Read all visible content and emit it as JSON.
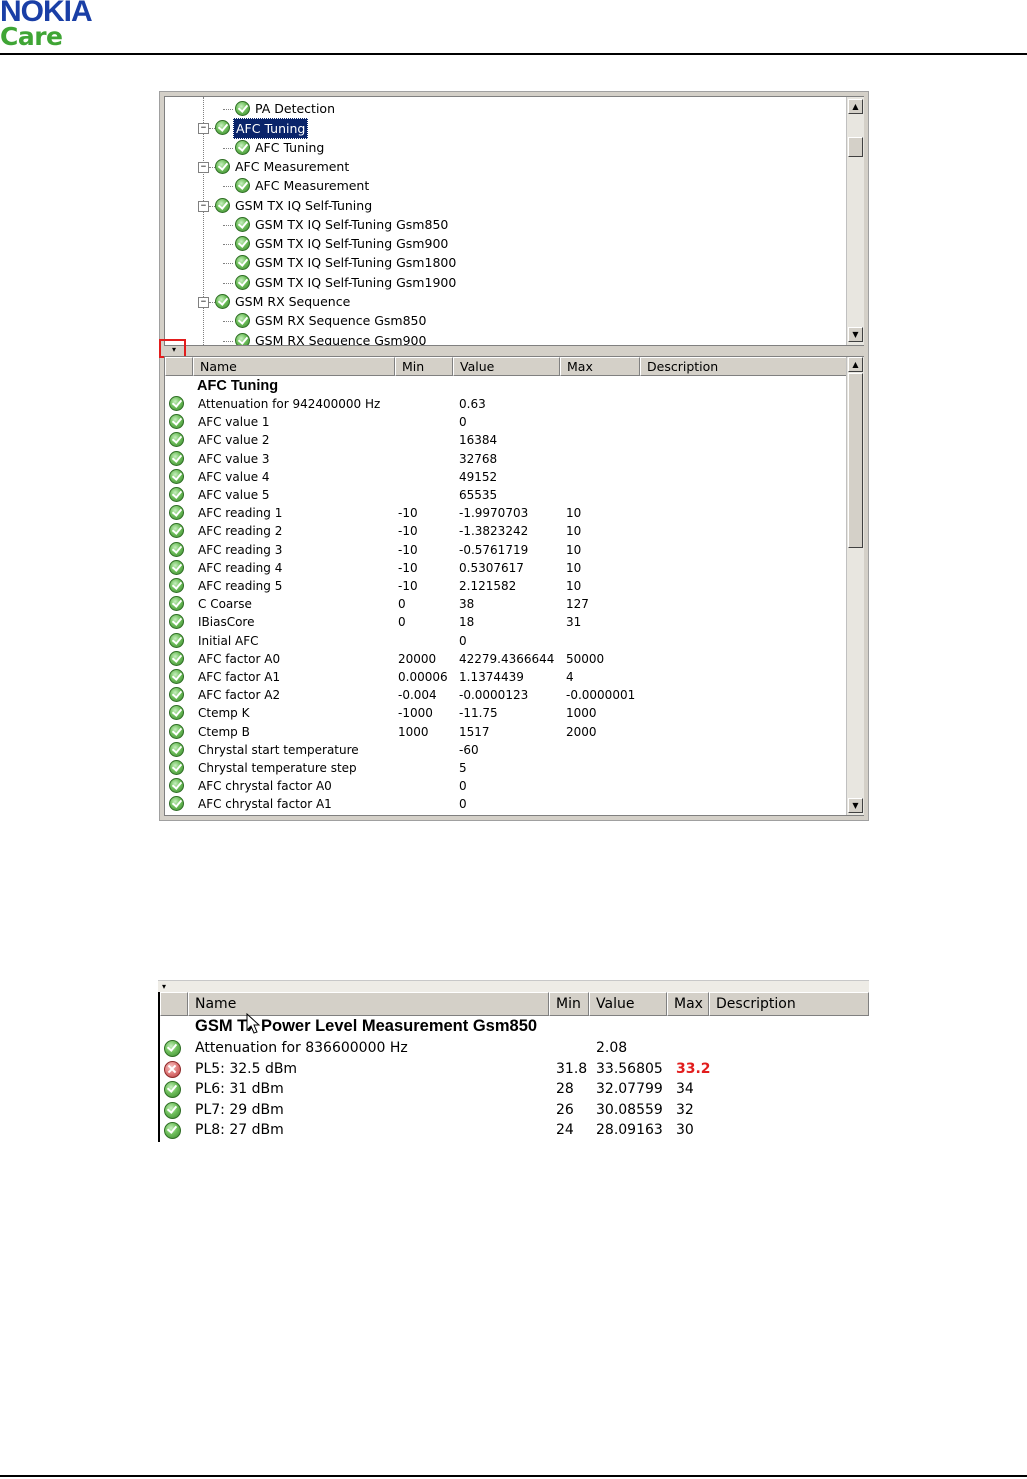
{
  "header": {
    "brand_primary": "NOKIA",
    "brand_secondary": "Care"
  },
  "tree": {
    "items": [
      {
        "label": "PA Detection",
        "level": 2,
        "expander": ""
      },
      {
        "label": "AFC Tuning",
        "level": 1,
        "expander": "-",
        "selected": true
      },
      {
        "label": "AFC Tuning",
        "level": 2,
        "expander": ""
      },
      {
        "label": "AFC Measurement",
        "level": 1,
        "expander": "-"
      },
      {
        "label": "AFC Measurement",
        "level": 2,
        "expander": ""
      },
      {
        "label": "GSM TX IQ Self-Tuning",
        "level": 1,
        "expander": "-"
      },
      {
        "label": "GSM TX IQ Self-Tuning Gsm850",
        "level": 2,
        "expander": ""
      },
      {
        "label": "GSM TX IQ Self-Tuning Gsm900",
        "level": 2,
        "expander": ""
      },
      {
        "label": "GSM TX IQ Self-Tuning Gsm1800",
        "level": 2,
        "expander": ""
      },
      {
        "label": "GSM TX IQ Self-Tuning Gsm1900",
        "level": 2,
        "expander": ""
      },
      {
        "label": "GSM RX Sequence",
        "level": 1,
        "expander": "-"
      },
      {
        "label": "GSM RX Sequence Gsm850",
        "level": 2,
        "expander": ""
      },
      {
        "label": "GSM RX Sequence Gsm900",
        "level": 2,
        "expander": ""
      }
    ]
  },
  "grid1": {
    "columns": [
      "Name",
      "Min",
      "Value",
      "Max",
      "Description"
    ],
    "title": "AFC Tuning",
    "rows": [
      {
        "status": "pass",
        "name": "Attenuation for 942400000 Hz",
        "min": "",
        "value": "0.63",
        "max": ""
      },
      {
        "status": "pass",
        "name": "AFC value 1",
        "min": "",
        "value": "0",
        "max": ""
      },
      {
        "status": "pass",
        "name": "AFC value 2",
        "min": "",
        "value": "16384",
        "max": ""
      },
      {
        "status": "pass",
        "name": "AFC value 3",
        "min": "",
        "value": "32768",
        "max": ""
      },
      {
        "status": "pass",
        "name": "AFC value 4",
        "min": "",
        "value": "49152",
        "max": ""
      },
      {
        "status": "pass",
        "name": "AFC value 5",
        "min": "",
        "value": "65535",
        "max": ""
      },
      {
        "status": "pass",
        "name": "AFC reading 1",
        "min": "-10",
        "value": "-1.9970703",
        "max": "10"
      },
      {
        "status": "pass",
        "name": "AFC reading 2",
        "min": "-10",
        "value": "-1.3823242",
        "max": "10"
      },
      {
        "status": "pass",
        "name": "AFC reading 3",
        "min": "-10",
        "value": "-0.5761719",
        "max": "10"
      },
      {
        "status": "pass",
        "name": "AFC reading 4",
        "min": "-10",
        "value": "0.5307617",
        "max": "10"
      },
      {
        "status": "pass",
        "name": "AFC reading 5",
        "min": "-10",
        "value": "2.121582",
        "max": "10"
      },
      {
        "status": "pass",
        "name": "C Coarse",
        "min": "0",
        "value": "38",
        "max": "127"
      },
      {
        "status": "pass",
        "name": "IBiasCore",
        "min": "0",
        "value": "18",
        "max": "31"
      },
      {
        "status": "pass",
        "name": "Initial AFC",
        "min": "",
        "value": "0",
        "max": ""
      },
      {
        "status": "pass",
        "name": "AFC factor A0",
        "min": "20000",
        "value": "42279.4366644",
        "max": "50000"
      },
      {
        "status": "pass",
        "name": "AFC factor A1",
        "min": "0.00006",
        "value": "1.1374439",
        "max": "4"
      },
      {
        "status": "pass",
        "name": "AFC factor A2",
        "min": "-0.004",
        "value": "-0.0000123",
        "max": "-0.0000001"
      },
      {
        "status": "pass",
        "name": "Ctemp K",
        "min": "-1000",
        "value": "-11.75",
        "max": "1000"
      },
      {
        "status": "pass",
        "name": "Ctemp B",
        "min": "1000",
        "value": "1517",
        "max": "2000"
      },
      {
        "status": "pass",
        "name": "Chrystal start temperature",
        "min": "",
        "value": "-60",
        "max": ""
      },
      {
        "status": "pass",
        "name": "Chrystal temperature step",
        "min": "",
        "value": "5",
        "max": ""
      },
      {
        "status": "pass",
        "name": "AFC chrystal factor A0",
        "min": "",
        "value": "0",
        "max": ""
      },
      {
        "status": "pass",
        "name": "AFC chrystal factor A1",
        "min": "",
        "value": "0",
        "max": ""
      }
    ]
  },
  "grid2": {
    "columns": [
      "Name",
      "Min",
      "Value",
      "Max",
      "Description"
    ],
    "title": "GSM Tx Power Level Measurement Gsm850",
    "rows": [
      {
        "status": "pass",
        "name": "Attenuation for 836600000 Hz",
        "min": "",
        "value": "2.08",
        "max": ""
      },
      {
        "status": "fail",
        "name": "PL5: 32.5 dBm",
        "min": "31.8",
        "value": "33.56805",
        "max": "33.2"
      },
      {
        "status": "pass",
        "name": "PL6: 31 dBm",
        "min": "28",
        "value": "32.07799",
        "max": "34"
      },
      {
        "status": "pass",
        "name": "PL7: 29 dBm",
        "min": "26",
        "value": "30.08559",
        "max": "32"
      },
      {
        "status": "pass",
        "name": "PL8: 27 dBm",
        "min": "24",
        "value": "28.09163",
        "max": "30"
      }
    ]
  },
  "colors": {
    "fail_text": "#e21d1d",
    "selection": "#0a246a",
    "nokia_blue": "#1a3fa6",
    "care_green": "#3fa535"
  }
}
